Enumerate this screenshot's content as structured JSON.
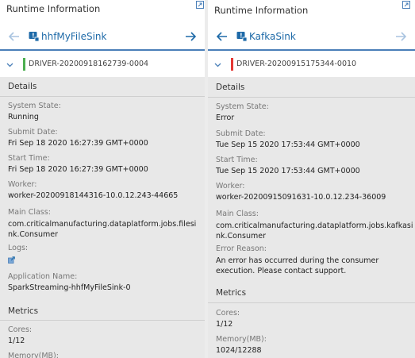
{
  "left_panel": {
    "title": "Runtime Information",
    "job_name": "hhfMyFileSink",
    "driver_id": "DRIVER-20200918162739-0004",
    "status_color": "#4caf50",
    "details_header": "Details",
    "fields": {
      "system_state": {
        "label": "System State:",
        "value": "Running"
      },
      "submit_date": {
        "label": "Submit Date:",
        "value": "Fri Sep 18 2020 16:27:39 GMT+0000"
      },
      "start_time": {
        "label": "Start Time:",
        "value": "Fri Sep 18 2020 16:27:39 GMT+0000"
      },
      "worker": {
        "label": "Worker:",
        "value": "worker-20200918144316-10.0.12.243-44665"
      },
      "main_class": {
        "label": "Main Class:",
        "value": "com.criticalmanufacturing.dataplatform.jobs.filesink.Consumer"
      },
      "logs": {
        "label": "Logs:",
        "icon": "external-link-icon"
      },
      "application_name": {
        "label": "Application Name:",
        "value": "SparkStreaming-hhfMyFileSink-0"
      }
    },
    "metrics_header": "Metrics",
    "metrics": {
      "cores": {
        "label": "Cores:",
        "value": "1/12"
      },
      "memory": {
        "label": "Memory(MB):"
      }
    }
  },
  "right_panel": {
    "title": "Runtime Information",
    "job_name": "KafkaSink",
    "driver_id": "DRIVER-20200915175344-0010",
    "status_color": "#e53935",
    "details_header": "Details",
    "fields": {
      "system_state": {
        "label": "System State:",
        "value": "Error"
      },
      "submit_date": {
        "label": "Submit Date:",
        "value": "Tue Sep 15 2020 17:53:44 GMT+0000"
      },
      "start_time": {
        "label": "Start Time:",
        "value": "Tue Sep 15 2020 17:53:44 GMT+0000"
      },
      "worker": {
        "label": "Worker:",
        "value": "worker-20200915091631-10.0.12.234-36009"
      },
      "main_class": {
        "label": "Main Class:",
        "value": "com.criticalmanufacturing.dataplatform.jobs.kafkasink.Consumer"
      },
      "error_reason": {
        "label": "Error Reason:",
        "value": "An error has occurred during the consumer execution. Please contact support."
      }
    },
    "metrics_header": "Metrics",
    "metrics": {
      "cores": {
        "label": "Cores:",
        "value": "1/12"
      },
      "memory": {
        "label": "Memory(MB):",
        "value": "1024/12288"
      }
    }
  },
  "colors": {
    "accent": "#1e6aa8",
    "nav_underline": "#4a7fb8",
    "content_bg": "#e8e8e8"
  }
}
